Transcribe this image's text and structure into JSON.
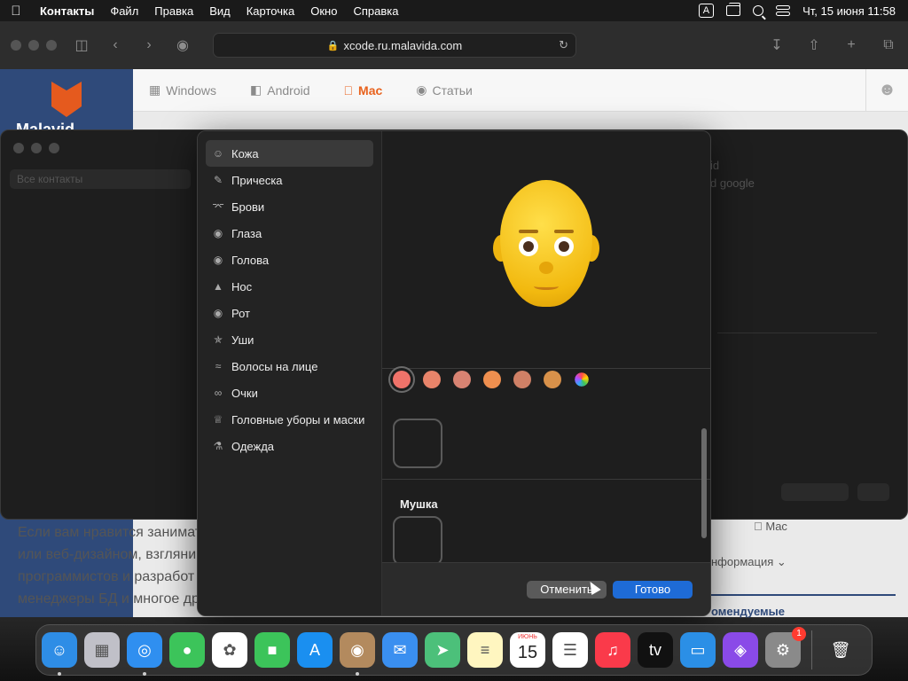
{
  "menubar": {
    "items": [
      "Контакты",
      "Файл",
      "Правка",
      "Вид",
      "Карточка",
      "Окно",
      "Справка"
    ],
    "input_indicator": "A",
    "clock": "Чт, 15 июня  11:58"
  },
  "browser": {
    "url": "xcode.ru.malavida.com",
    "site_logo_text": "Malavid",
    "nav": [
      "Windows",
      "Android",
      "Mac",
      "Статьи"
    ],
    "active_nav": "Mac",
    "page_text": [
      "Если вам нравится занимат",
      "или веб-дизайном, взгляни",
      "программистов и разработ",
      "менеджеры БД и многое др"
    ],
    "right_panel": {
      "mac": "Mac",
      "info": "нформация",
      "recommended": "омендуемые"
    }
  },
  "contacts": {
    "search_placeholder": "Все контакты",
    "ghost_lines": [
      "id",
      "d google"
    ]
  },
  "memoji": {
    "categories": [
      {
        "label": "Кожа",
        "icon": "face-icon"
      },
      {
        "label": "Прическа",
        "icon": "comb-icon"
      },
      {
        "label": "Брови",
        "icon": "eyebrow-icon"
      },
      {
        "label": "Глаза",
        "icon": "eyes-icon"
      },
      {
        "label": "Голова",
        "icon": "head-icon"
      },
      {
        "label": "Нос",
        "icon": "nose-icon"
      },
      {
        "label": "Рот",
        "icon": "lips-icon"
      },
      {
        "label": "Уши",
        "icon": "ear-icon"
      },
      {
        "label": "Волосы на лице",
        "icon": "mustache-icon"
      },
      {
        "label": "Очки",
        "icon": "glasses-icon"
      },
      {
        "label": "Головные уборы и маски",
        "icon": "crown-icon"
      },
      {
        "label": "Одежда",
        "icon": "person-icon"
      }
    ],
    "selected_category": "Кожа",
    "skin_colors": [
      "#f0736a",
      "#e8846a",
      "#d88372",
      "#ef8f4f",
      "#cf8066",
      "#d8914a"
    ],
    "selected_color_index": 0,
    "section_title": "Мушка",
    "cancel_label": "Отменить",
    "done_label": "Готово"
  },
  "dock": {
    "apps": [
      {
        "name": "Finder",
        "color": "#2e8de6",
        "glyph": "☺",
        "running": true
      },
      {
        "name": "Launchpad",
        "color": "#c0c0c8",
        "glyph": "▦",
        "running": false
      },
      {
        "name": "Safari",
        "color": "#2f8ff0",
        "glyph": "◎",
        "running": true
      },
      {
        "name": "Messages",
        "color": "#3cc45a",
        "glyph": "●",
        "running": false
      },
      {
        "name": "Photos",
        "color": "#ffffff",
        "glyph": "✿",
        "running": false
      },
      {
        "name": "FaceTime",
        "color": "#3cc45a",
        "glyph": "■",
        "running": false
      },
      {
        "name": "App Store",
        "color": "#1a8ff0",
        "glyph": "A",
        "running": false
      },
      {
        "name": "Contacts",
        "color": "#b38a5e",
        "glyph": "◉",
        "running": true
      },
      {
        "name": "Mail",
        "color": "#3a8ff0",
        "glyph": "✉",
        "running": false
      },
      {
        "name": "Maps",
        "color": "#4cc07a",
        "glyph": "➤",
        "running": false
      },
      {
        "name": "Notes",
        "color": "#fff6c0",
        "glyph": "≡",
        "running": false
      },
      {
        "name": "Calendar",
        "color": "#ffffff",
        "month": "ИЮНЬ",
        "day": "15",
        "running": false
      },
      {
        "name": "Reminders",
        "color": "#ffffff",
        "glyph": "☰",
        "running": false
      },
      {
        "name": "Music",
        "color": "#fa3a4a",
        "glyph": "♫",
        "running": false
      },
      {
        "name": "Apple TV",
        "color": "#111111",
        "glyph": "tv",
        "running": false
      },
      {
        "name": "Keynote",
        "color": "#2b8fe6",
        "glyph": "▭",
        "running": false
      },
      {
        "name": "Podcasts",
        "color": "#8a4ae8",
        "glyph": "◈",
        "running": false
      },
      {
        "name": "System Preferences",
        "color": "#8a8a8a",
        "glyph": "⚙",
        "badge": "1",
        "running": false
      }
    ],
    "trash": "Trash"
  }
}
